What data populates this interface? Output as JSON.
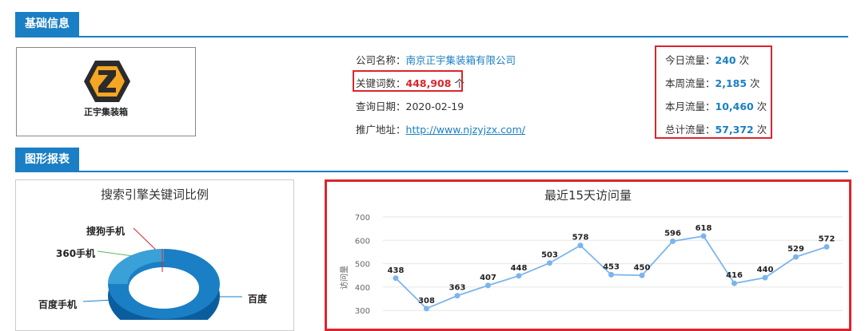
{
  "basic_section": {
    "title": "基础信息"
  },
  "company": {
    "logo_text": "正宇集装箱",
    "name_label": "公司名称：",
    "name_value": "南京正宇集装箱有限公司",
    "keywords_label": "关键词数：",
    "keywords_value": "448,908",
    "keywords_unit": "个",
    "date_label": "查询日期：",
    "date_value": "2020-02-19",
    "url_label": "推广地址：",
    "url_value": "http://www.njzyjzx.com/"
  },
  "traffic": {
    "unit": "次",
    "rows": [
      {
        "label": "今日流量：",
        "value": "240"
      },
      {
        "label": "本周流量：",
        "value": "2,185"
      },
      {
        "label": "本月流量：",
        "value": "10,460"
      },
      {
        "label": "总计流量：",
        "value": "57,372"
      }
    ]
  },
  "chart_section": {
    "title": "图形报表"
  },
  "pie_chart": {
    "title": "搜索引擎关键词比例",
    "labels": [
      "搜狗手机",
      "360手机",
      "百度手机",
      "百度"
    ],
    "colors": [
      "#1a7fc4",
      "#3aa0d8",
      "#0b5e9e"
    ]
  },
  "chart_data": {
    "type": "line",
    "title": "最近15天访问量",
    "ylabel": "访问量",
    "ylim": [
      300,
      700
    ],
    "yticks": [
      300,
      400,
      500,
      600,
      700
    ],
    "series": [
      {
        "values": [
          438,
          308,
          363,
          407,
          448,
          503,
          578,
          453,
          450,
          596,
          618,
          416,
          440,
          529,
          572
        ]
      }
    ],
    "grid": true,
    "color": "#7cb5ec"
  }
}
